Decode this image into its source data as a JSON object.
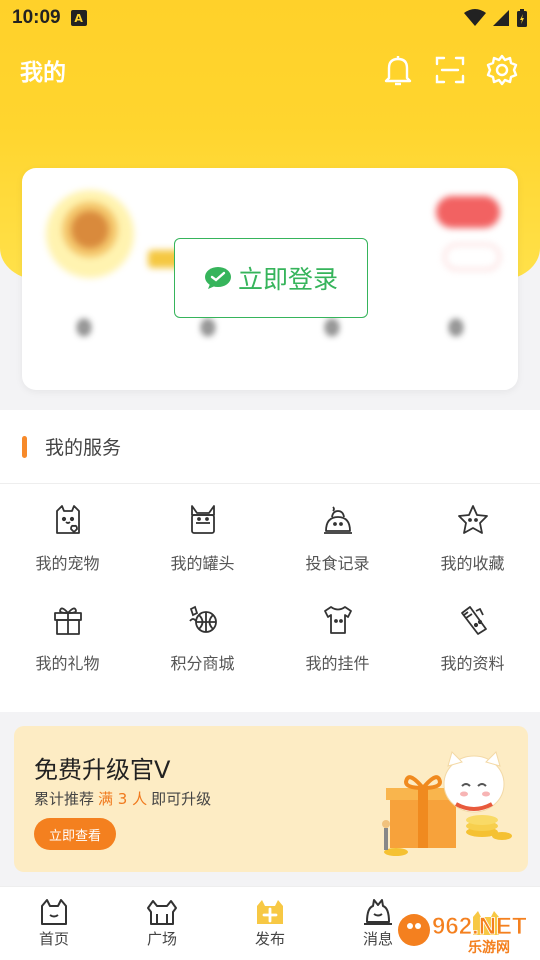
{
  "status_bar": {
    "time": "10:09",
    "notif_letter": "A"
  },
  "header": {
    "title": "我的"
  },
  "login": {
    "label": "立即登录"
  },
  "services": {
    "title": "我的服务",
    "items": [
      {
        "label": "我的宠物",
        "icon": "pet-icon"
      },
      {
        "label": "我的罐头",
        "icon": "can-icon"
      },
      {
        "label": "投食记录",
        "icon": "feed-record-icon"
      },
      {
        "label": "我的收藏",
        "icon": "star-icon"
      },
      {
        "label": "我的礼物",
        "icon": "gift-icon"
      },
      {
        "label": "积分商城",
        "icon": "points-mall-icon"
      },
      {
        "label": "我的挂件",
        "icon": "shirt-icon"
      },
      {
        "label": "我的资料",
        "icon": "profile-data-icon"
      }
    ]
  },
  "promo": {
    "title": "免费升级官V",
    "sub_pre": "累计推荐",
    "sub_highlight": "满 3 人",
    "sub_post": "即可升级",
    "button": "立即查看"
  },
  "nav": [
    {
      "label": "首页",
      "icon": "home-cat-icon"
    },
    {
      "label": "广场",
      "icon": "square-icon"
    },
    {
      "label": "发布",
      "icon": "publish-icon"
    },
    {
      "label": "消息",
      "icon": "message-icon"
    },
    {
      "label": "",
      "icon": "mine-icon"
    }
  ],
  "watermark": {
    "brand": "962.NET",
    "sub": "乐游网"
  },
  "colors": {
    "accent": "#ffd52e",
    "orange": "#f4801f",
    "green": "#36b45b"
  }
}
